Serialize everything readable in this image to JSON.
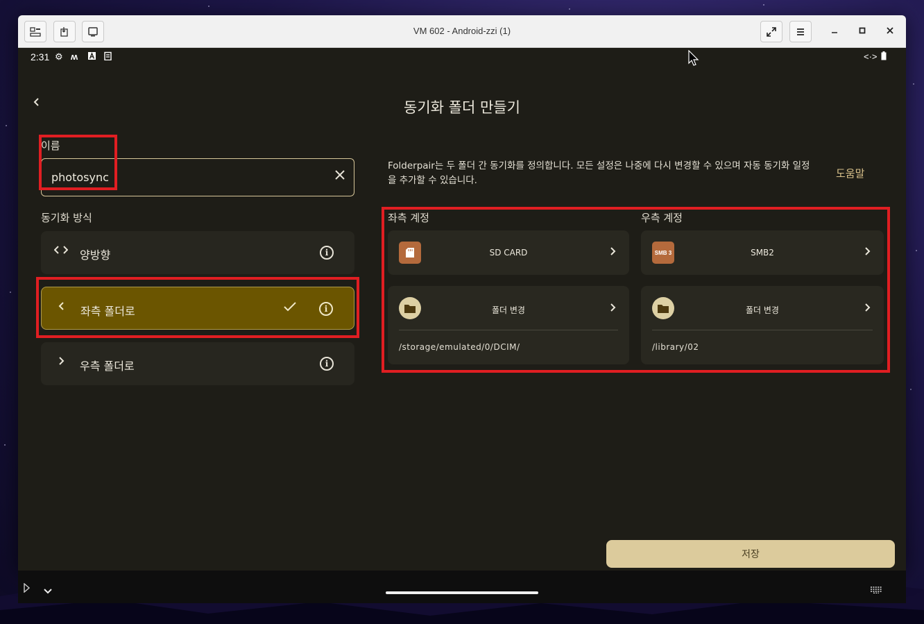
{
  "window": {
    "title": "VM 602 - Android-zzi (1)"
  },
  "statusbar": {
    "time": "2:31"
  },
  "app": {
    "page_title": "동기화 폴더 만들기",
    "name_label": "이름",
    "name_value": "photosync",
    "sync_mode_label": "동기화 방식",
    "sync_options": [
      {
        "label": "양방향",
        "icon": "code-brackets-icon",
        "selected": false
      },
      {
        "label": "좌측 폴더로",
        "icon": "chevron-left-icon",
        "selected": true
      },
      {
        "label": "우측 폴더로",
        "icon": "chevron-right-icon",
        "selected": false
      }
    ],
    "description": "Folderpair는 두 폴더 간 동기화를 정의합니다. 모든 설정은 나중에 다시 변경할 수 있으며 자동 동기화 일정을 추가할 수 있습니다.",
    "help_label": "도움말",
    "left_account_label": "좌측 계정",
    "right_account_label": "우측 계정",
    "left": {
      "account_name": "SD CARD",
      "folder_button": "폴더 변경",
      "folder_path": "/storage/emulated/0/DCIM/"
    },
    "right": {
      "account_name": "SMB2",
      "account_badge": "SMB 3",
      "folder_button": "폴더 변경",
      "folder_path": "/library/02"
    },
    "save_label": "저장"
  },
  "colors": {
    "accent": "#dccb9c",
    "selected_bg": "#6b5500",
    "highlight_box": "#e01e22",
    "background": "#1e1d17"
  }
}
